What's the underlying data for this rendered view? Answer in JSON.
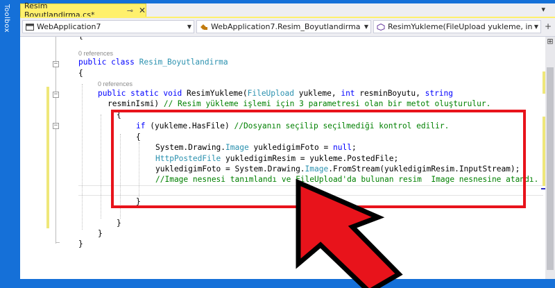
{
  "toolbox": {
    "label": "Toolbox"
  },
  "tab": {
    "title": "Resim Boyutlandirma.cs*",
    "pin_icon": "pin-icon",
    "close_icon": "close-icon"
  },
  "navbar": {
    "project": "WebApplication7",
    "class": "WebApplication7.Resim_Boyutlandirma",
    "member": "ResimYukleme(FileUpload yukleme, int re"
  },
  "code": {
    "refs_class": "0 references",
    "refs_method": "0 references",
    "lines": {
      "l_brace_open": "{",
      "l_class_kw1": "public",
      "l_class_kw2": "class",
      "l_class_name": "Resim_Boyutlandirma",
      "l_class_brace": "{",
      "l_method_public": "public",
      "l_method_static": "static",
      "l_method_void": "void",
      "l_method_name": "ResimYukleme(",
      "l_method_type1": "FileUpload",
      "l_method_p1": " yukleme, ",
      "l_method_int": "int",
      "l_method_p2": " resminBoyutu, ",
      "l_method_string": "string",
      "l_method_cont": "resminIsmi)",
      "l_method_comment": " // Resim yükleme işlemi için 3 parametresi olan bir metot oluşturulur.",
      "l_method_brace": "{",
      "l_if_kw": "if",
      "l_if_cond": " (yukleme.HasFile) ",
      "l_if_comment": "//Dosyanın seçilip seçilmediği kontrol edilir.",
      "l_if_brace": "{",
      "l_s1_a": "System.Drawing.",
      "l_s1_type": "Image",
      "l_s1_b": " yukledigimFoto = ",
      "l_s1_null": "null",
      "l_s1_c": ";",
      "l_s2_type": "HttpPostedFile",
      "l_s2_b": " yukledigimResim = yukleme.PostedFile;",
      "l_s3_a": "yukledigimFoto = System.Drawing.",
      "l_s3_type": "Image",
      "l_s3_b": ".FromStream(yukledigimResim.InputStream);",
      "l_s4_comment": "//Image nesnesi tanımlandı ve FileUpload'da bulunan resim  Image nesnesine atandı.",
      "l_if_close": "}",
      "l_method_close": "}",
      "l_class_close": "}",
      "l_ns_close": "}"
    }
  },
  "colors": {
    "keyword": "#0000ff",
    "type": "#2b91af",
    "comment": "#008000",
    "highlight_box": "#e8131b",
    "tab_active": "#fff06c",
    "frame_blue": "#1570d8"
  }
}
